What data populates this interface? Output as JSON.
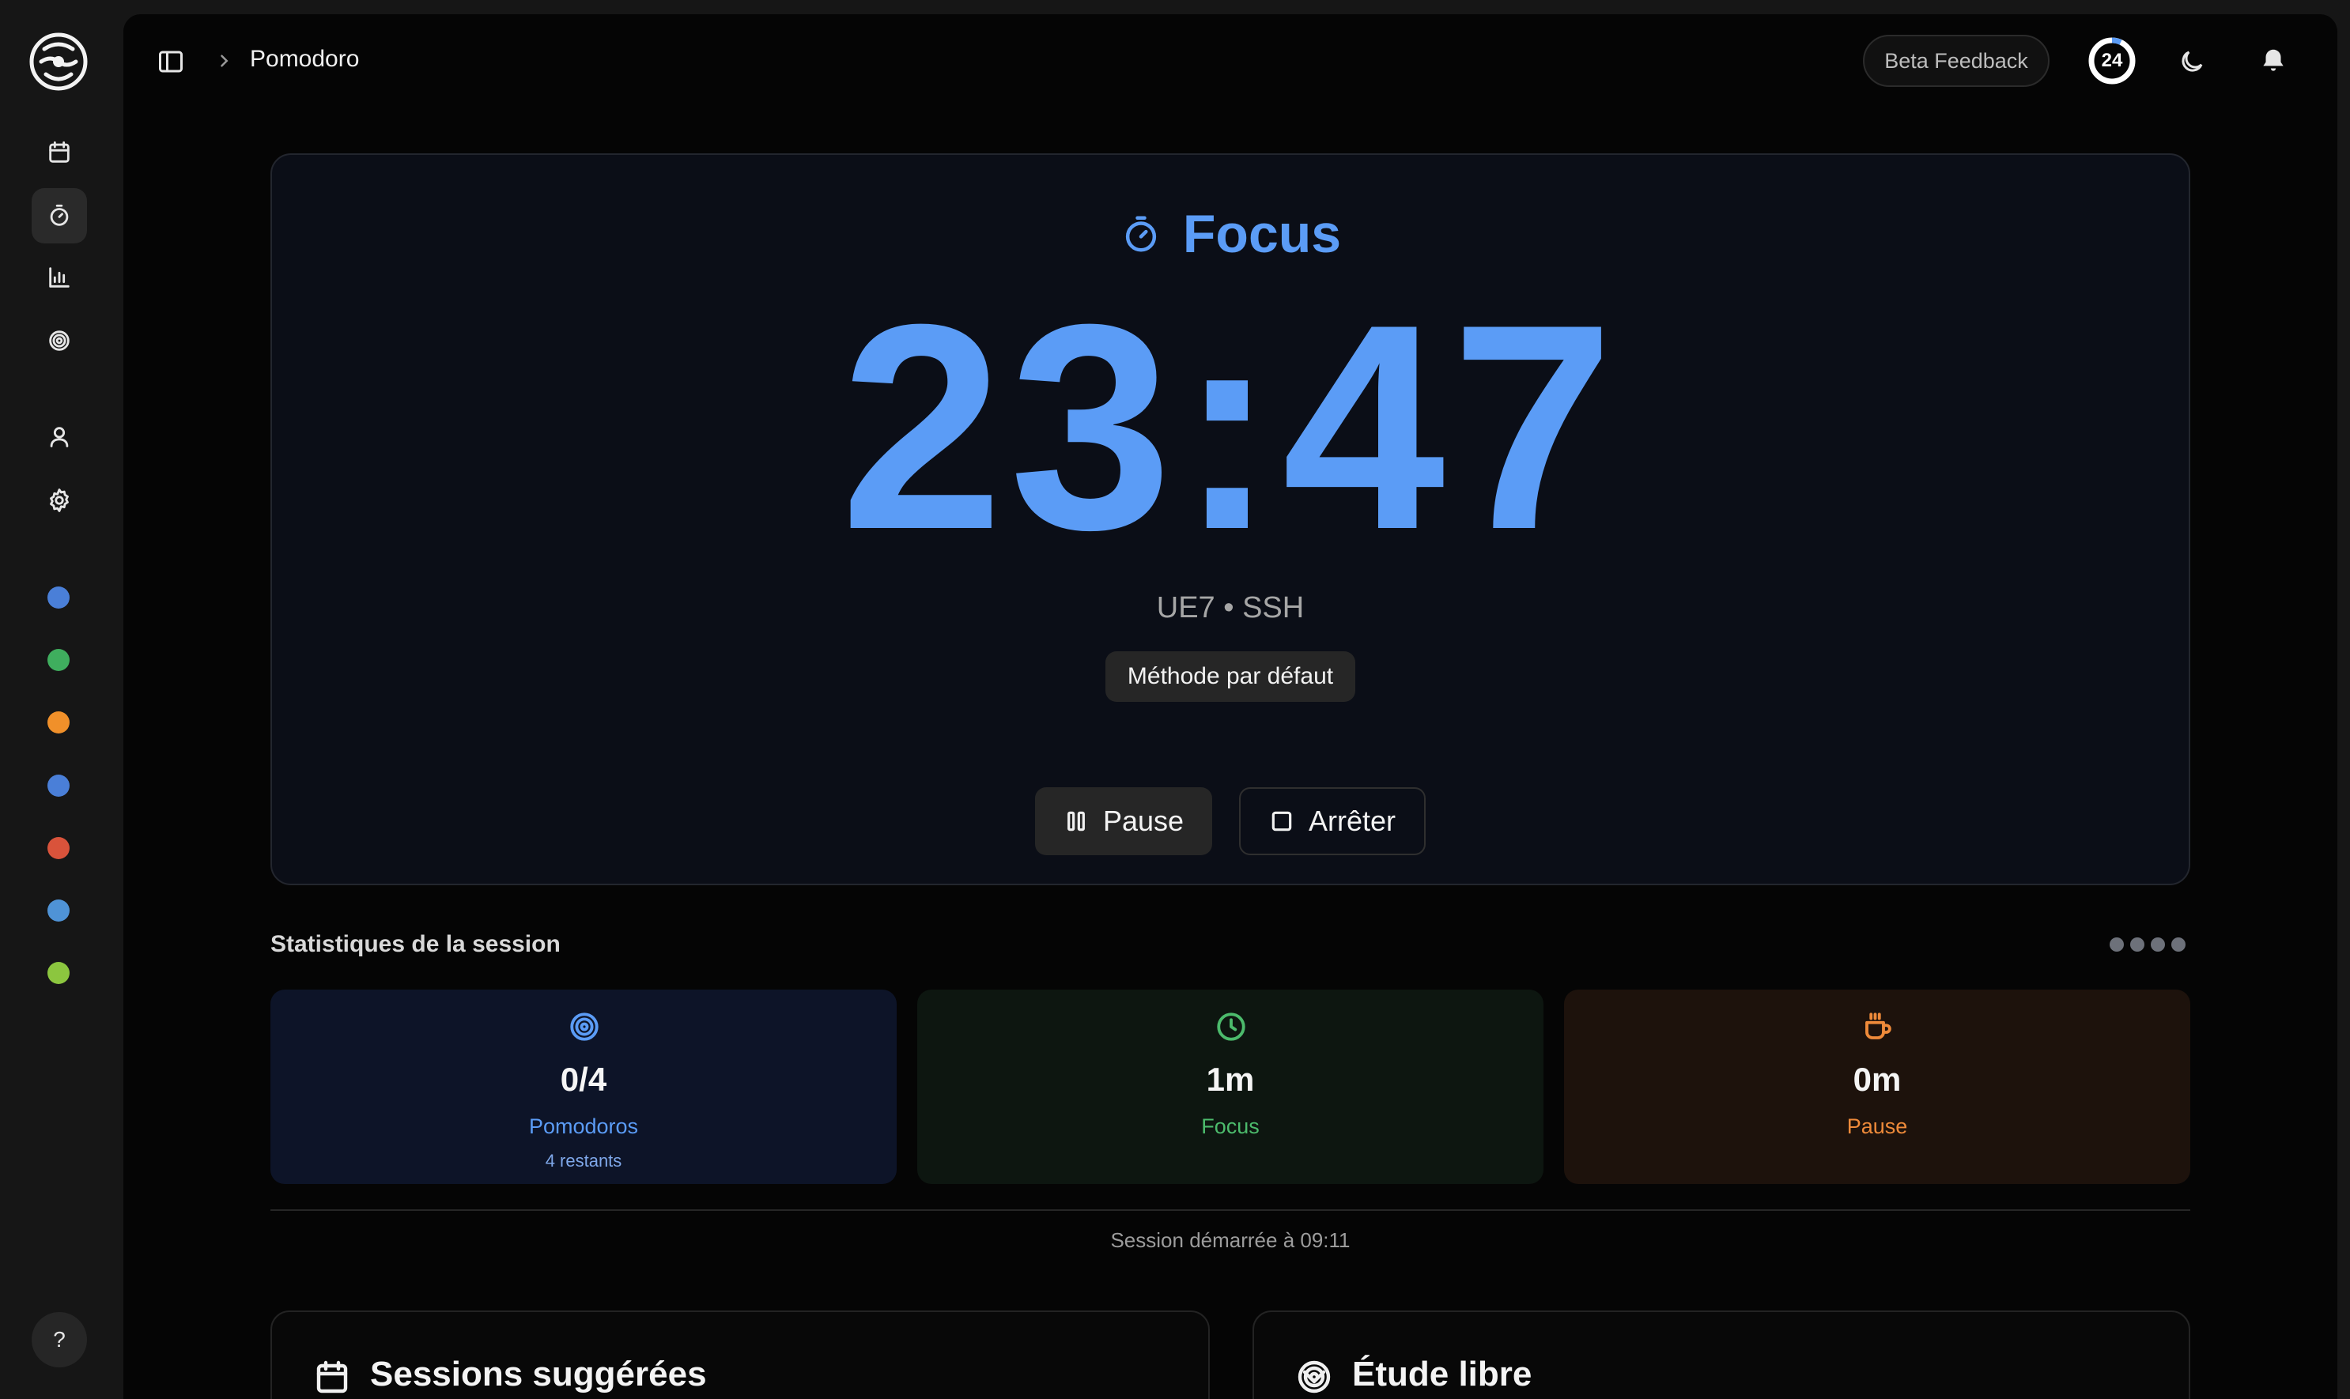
{
  "header": {
    "breadcrumb": "Pomodoro",
    "beta_feedback": "Beta Feedback",
    "streak_count": "24"
  },
  "sidebar": {
    "items": [
      {
        "name": "calendar-icon",
        "active": false
      },
      {
        "name": "timer-icon",
        "active": true
      },
      {
        "name": "chart-icon",
        "active": false
      },
      {
        "name": "target-icon",
        "active": false
      },
      {
        "name": "user-icon",
        "active": false
      },
      {
        "name": "gear-icon",
        "active": false
      }
    ],
    "subject_colors": [
      "#4a7fd8",
      "#3fae5e",
      "#f0902a",
      "#4a7fd8",
      "#d9533b",
      "#4f93d6",
      "#8cc63f"
    ],
    "help_label": "?"
  },
  "focus": {
    "mode": "Focus",
    "time": "23:47",
    "subject": "UE7 • SSH",
    "method": "Méthode par défaut",
    "pause_label": "Pause",
    "stop_label": "Arrêter"
  },
  "stats": {
    "title": "Statistiques de la session",
    "cards": [
      {
        "value": "0/4",
        "label": "Pomodoros",
        "sub": "4 restants",
        "color": "#5b9cf6"
      },
      {
        "value": "1m",
        "label": "Focus",
        "color": "#4cbb6c"
      },
      {
        "value": "0m",
        "label": "Pause",
        "color": "#ee8a3a"
      }
    ],
    "started": "Session démarrée à 09:11"
  },
  "bottom": {
    "suggested_title": "Sessions suggérées",
    "free_title": "Étude libre"
  },
  "colors": {
    "accent": "#5b9cf6",
    "background": "#050505",
    "rail": "#161616"
  }
}
